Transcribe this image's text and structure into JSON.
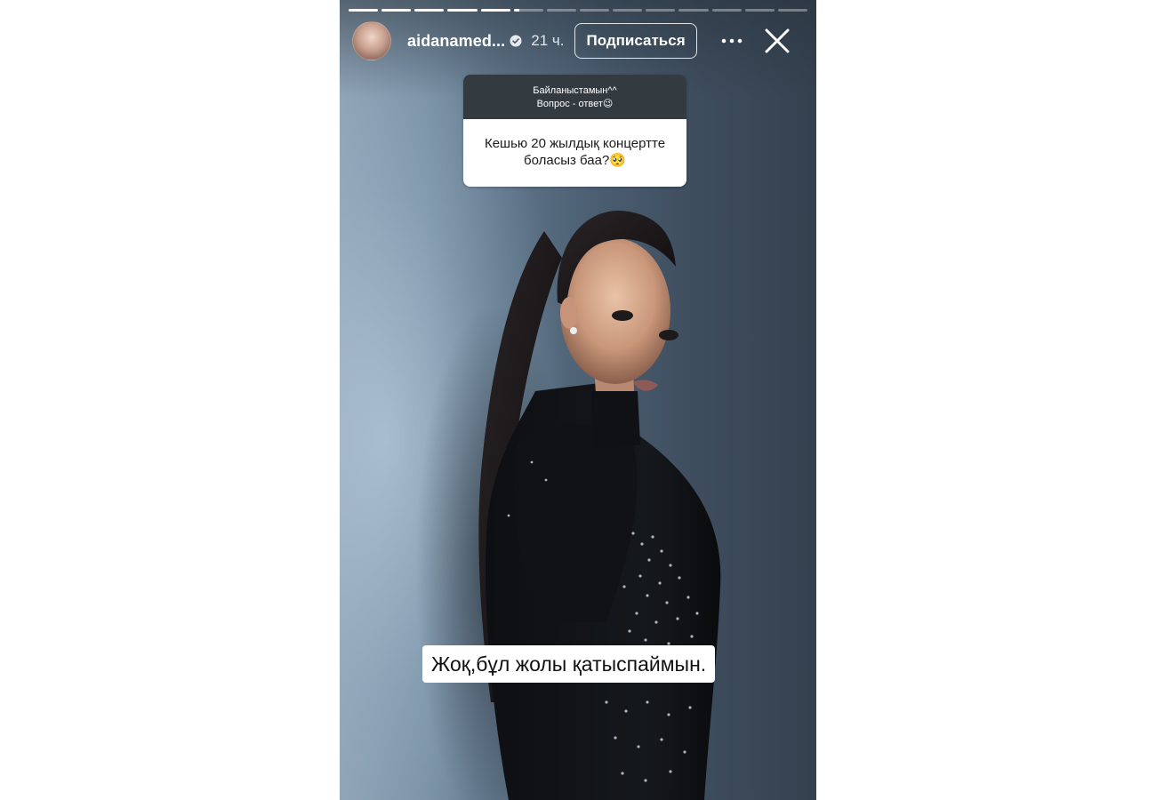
{
  "story": {
    "progress_segments": 14,
    "progress_active_index": 5,
    "progress_active_fill": 0.2
  },
  "header": {
    "username": "aidanamed...",
    "verified_icon": "verified-badge-icon",
    "time": "21 ч.",
    "follow_label": "Подписаться",
    "more_icon": "more-horizontal-icon",
    "close_icon": "close-icon"
  },
  "question_sticker": {
    "title_line1": "Байланыстамын^^",
    "title_line2": "Вопрос - ответ😉",
    "question_line1": "Кешью 20 жылдық концертте",
    "question_line2": "боласыз баа?🥺"
  },
  "answer_text": "Жоқ,бұл жолы қатыспаймын.",
  "colors": {
    "overlay_text": "#ffffff",
    "sticker_header": "#333a40",
    "sticker_body": "#ffffff"
  }
}
